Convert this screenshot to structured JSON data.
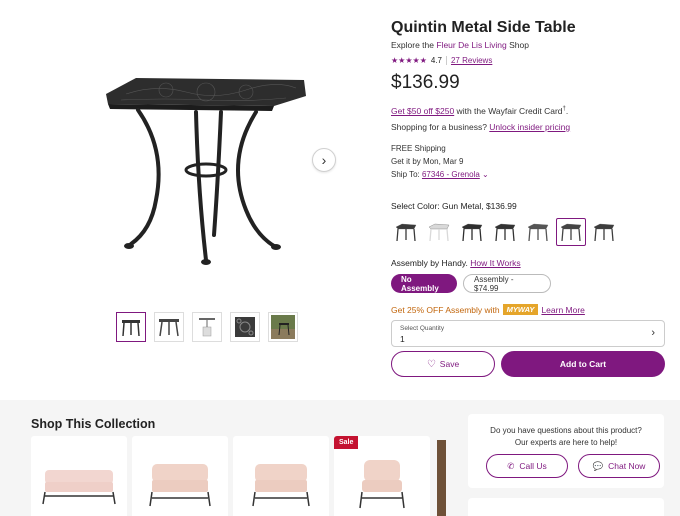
{
  "product": {
    "title": "Quintin Metal Side Table",
    "explore_prefix": "Explore the ",
    "brand": "Fleur De Lis Living",
    "explore_suffix": " Shop",
    "stars": "★★★★★",
    "rating": "4.7",
    "reviews": "27 Reviews",
    "price": "$136.99",
    "credit_link": "Get $50 off $250",
    "credit_text": " with the Wayfair Credit Card",
    "credit_sup": "†",
    "business_prefix": "Shopping for a business? ",
    "business_link": "Unlock insider pricing",
    "free_shipping": "FREE Shipping",
    "delivery": "Get it by Mon, Mar 9",
    "ship_to_label": "Ship To: ",
    "ship_to_value": "67346 - Grenola",
    "color_label": "Select Color: Gun Metal, $136.99",
    "assembly_label": "Assembly by Handy. ",
    "assembly_link": "How It Works",
    "assembly_options": [
      "No Assembly",
      "Assembly - $74.99"
    ],
    "promo_text": "Get 25% OFF Assembly with",
    "promo_badge": "MYWAY",
    "promo_link": "Learn More",
    "qty_label": "Select Quantity",
    "qty_value": "1",
    "save_label": "Save",
    "cart_label": "Add to Cart"
  },
  "gallery": {
    "next_icon": "chevron-right-icon"
  },
  "swatches": [
    {
      "name": "dark",
      "color": "#3a3a3a",
      "selected": false
    },
    {
      "name": "white",
      "color": "#d9d9d9",
      "selected": false
    },
    {
      "name": "black",
      "color": "#2e2e2e",
      "selected": false
    },
    {
      "name": "black-2",
      "color": "#333333",
      "selected": false
    },
    {
      "name": "gray",
      "color": "#555555",
      "selected": false
    },
    {
      "name": "gun-metal",
      "color": "#444444",
      "selected": true
    },
    {
      "name": "charcoal",
      "color": "#3d3d3d",
      "selected": false
    }
  ],
  "collection": {
    "title": "Shop This Collection",
    "sale_badge": "Sale"
  },
  "help": {
    "question": "Do you have questions about this product? Our experts are here to help!",
    "call_label": "Call Us",
    "chat_label": "Chat Now"
  },
  "colors": {
    "brand": "#7f187f",
    "sale": "#c41230",
    "myway": "#e5a52a"
  }
}
